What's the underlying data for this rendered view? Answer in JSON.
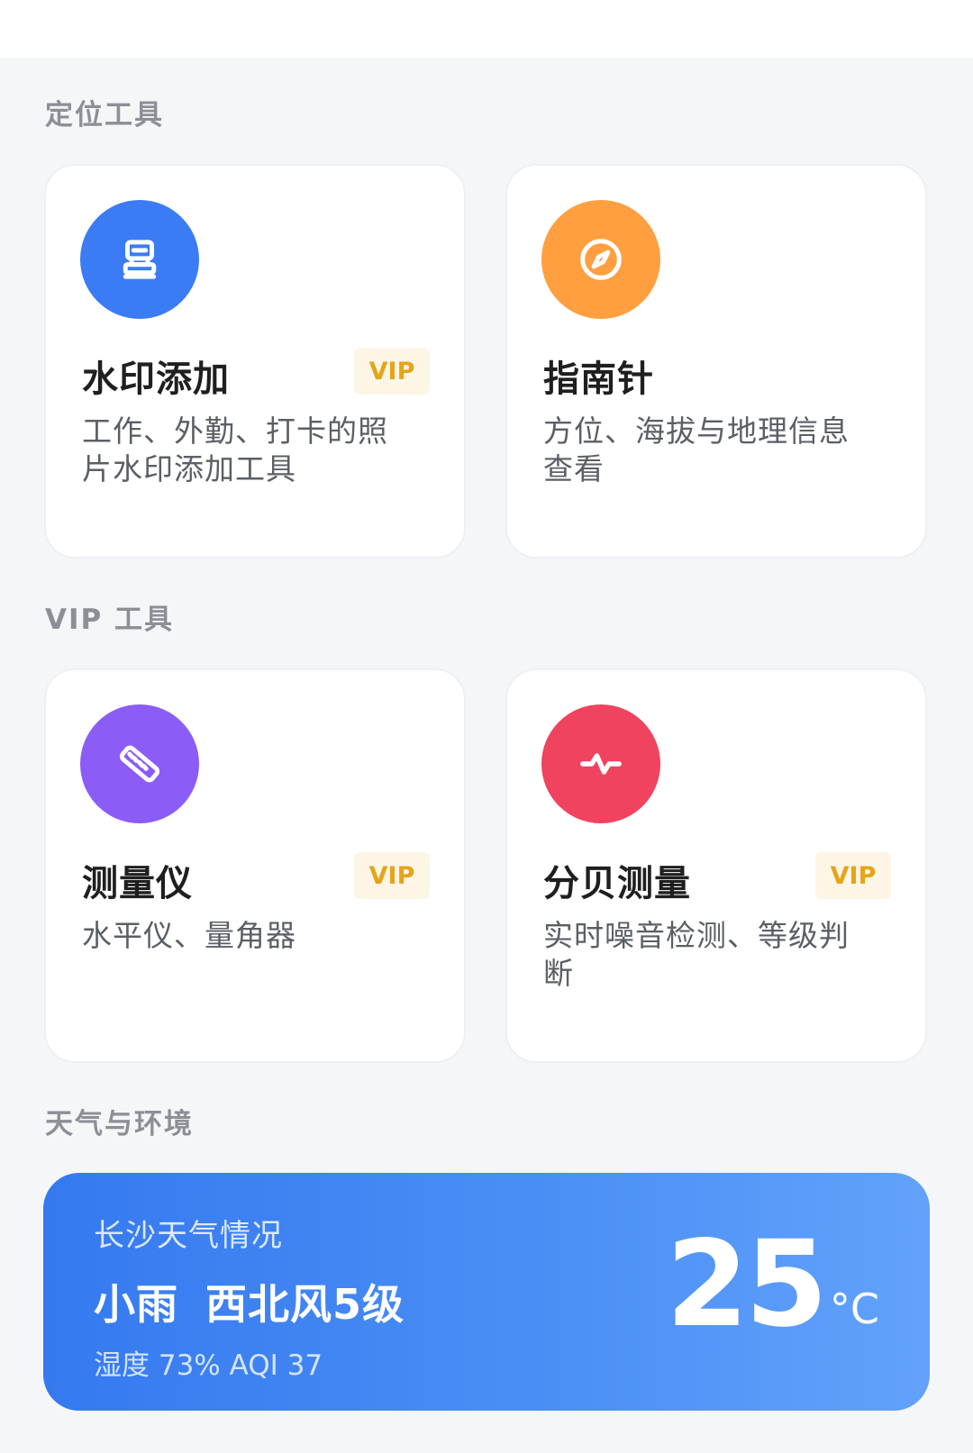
{
  "sections": {
    "location": "定位工具",
    "vip": "VIP 工具",
    "weather": "天气与环境"
  },
  "cards": [
    {
      "title": "水印添加",
      "desc": "工作、外勤、打卡的照片水印添加工具",
      "vip": "VIP",
      "icon": "stamp-icon",
      "color": "#3b7cf5"
    },
    {
      "title": "指南针",
      "desc": "方位、海拔与地理信息查看",
      "vip": "",
      "icon": "compass-icon",
      "color": "#ff9f40"
    },
    {
      "title": "测量仪",
      "desc": "水平仪、量角器",
      "vip": "VIP",
      "icon": "ruler-icon",
      "color": "#8b5cf6"
    },
    {
      "title": "分贝测量",
      "desc": "实时噪音检测、等级判断",
      "vip": "VIP",
      "icon": "pulse-icon",
      "color": "#f0435f"
    }
  ],
  "weather": {
    "city_label": "长沙天气情况",
    "condition": "小雨",
    "wind": "西北风5级",
    "meta": "湿度 73% AQI 37",
    "temperature": "25",
    "unit": "°C"
  }
}
